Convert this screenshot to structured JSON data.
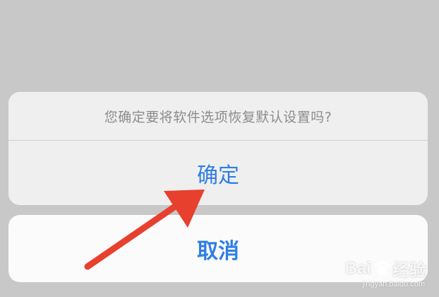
{
  "dialog": {
    "message": "您确定要将软件选项恢复默认设置吗?",
    "confirm_label": "确定",
    "cancel_label": "取消"
  },
  "watermark": {
    "brand_left": "Bai",
    "brand_right": "经验",
    "url": "jingyan.baidu.com"
  },
  "colors": {
    "background": "#c8c8c8",
    "action_text": "#2e7ee3",
    "arrow": "#e8402e"
  },
  "icons": {
    "arrow": "red-pointer-arrow-icon",
    "watermark": "baidu-paw-icon"
  }
}
